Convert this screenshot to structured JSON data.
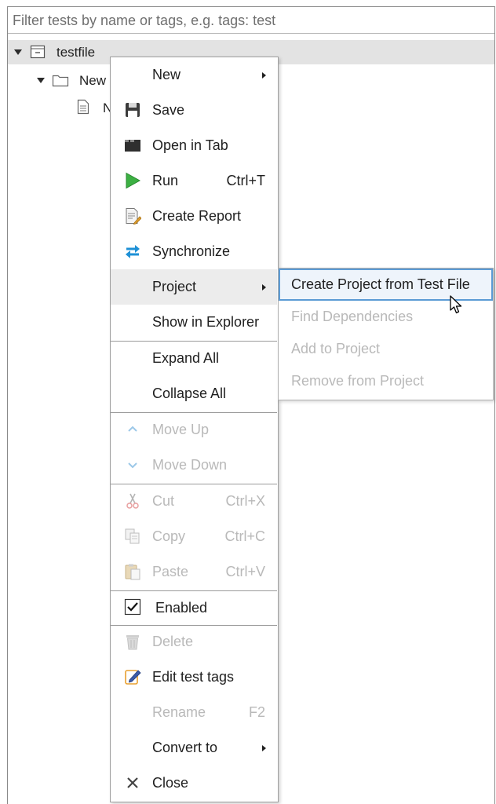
{
  "filter": {
    "placeholder": "Filter tests by name or tags, e.g. tags: test"
  },
  "tree": {
    "root": {
      "label": "testfile",
      "icon": "test-file-icon"
    },
    "child": {
      "label": "New",
      "icon": "folder-icon"
    },
    "grandchild": {
      "label": "N",
      "icon": "document-icon"
    }
  },
  "context_menu": {
    "new": {
      "label": "New"
    },
    "save": {
      "label": "Save",
      "icon": "save-icon"
    },
    "open_in_tab": {
      "label": "Open in Tab",
      "icon": "open-tab-icon"
    },
    "run": {
      "label": "Run",
      "shortcut": "Ctrl+T",
      "icon": "run-icon"
    },
    "create_report": {
      "label": "Create Report",
      "icon": "report-icon"
    },
    "synchronize": {
      "label": "Synchronize",
      "icon": "sync-icon"
    },
    "project": {
      "label": "Project"
    },
    "show_in_explorer": {
      "label": "Show in Explorer"
    },
    "expand_all": {
      "label": "Expand All"
    },
    "collapse_all": {
      "label": "Collapse All"
    },
    "move_up": {
      "label": "Move Up",
      "icon": "chevron-up-icon",
      "disabled": true
    },
    "move_down": {
      "label": "Move Down",
      "icon": "chevron-down-icon",
      "disabled": true
    },
    "cut": {
      "label": "Cut",
      "shortcut": "Ctrl+X",
      "icon": "scissors-icon",
      "disabled": true
    },
    "copy": {
      "label": "Copy",
      "shortcut": "Ctrl+C",
      "icon": "copy-icon",
      "disabled": true
    },
    "paste": {
      "label": "Paste",
      "shortcut": "Ctrl+V",
      "icon": "paste-icon",
      "disabled": true
    },
    "enabled": {
      "label": "Enabled",
      "checked": true
    },
    "delete": {
      "label": "Delete",
      "icon": "trash-icon",
      "disabled": true
    },
    "edit_tags": {
      "label": "Edit test tags",
      "icon": "edit-tags-icon"
    },
    "rename": {
      "label": "Rename",
      "shortcut": "F2",
      "disabled": true
    },
    "convert_to": {
      "label": "Convert to"
    },
    "close": {
      "label": "Close",
      "icon": "close-icon"
    }
  },
  "project_submenu": {
    "create_project": {
      "label": "Create Project from Test File",
      "highlighted": true
    },
    "find_dependencies": {
      "label": "Find Dependencies",
      "disabled": true
    },
    "add_to_project": {
      "label": "Add to Project",
      "disabled": true
    },
    "remove_from_project": {
      "label": "Remove from Project",
      "disabled": true
    }
  },
  "colors": {
    "highlight_border": "#5b9bd5",
    "disabled_text": "#b9b9b9",
    "run_green": "#3cb043",
    "sync_blue": "#1e90d6"
  }
}
